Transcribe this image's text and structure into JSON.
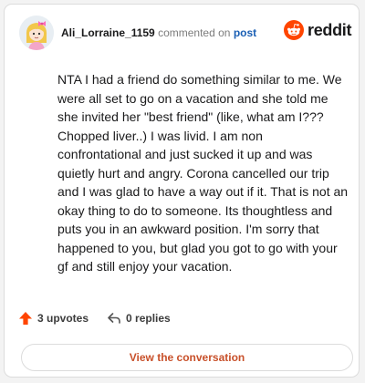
{
  "header": {
    "username": "Ali_Lorraine_1159",
    "action": "commented on",
    "post_link": "post",
    "brand": "reddit"
  },
  "comment": {
    "text": "NTA I had a friend do something similar to me. We were all set to go on a vacation and she told me she invited her \"best friend\" (like, what am I??? Chopped liver..) I was livid. I am non confrontational and just sucked it up and was quietly hurt and angry. Corona cancelled our trip and I was glad to have a way out if it. That is not an okay thing to do to someone. Its thoughtless and puts you in an awkward position. I'm sorry that happened to you, but glad you got to go with your gf and still enjoy your vacation."
  },
  "stats": {
    "upvotes": "3 upvotes",
    "replies": "0 replies"
  },
  "footer": {
    "view_button": "View the conversation"
  },
  "colors": {
    "reddit_orange": "#ff4500",
    "upvote": "#ff4500",
    "link_blue": "#1a5fb4",
    "button_text": "#c8502a"
  },
  "icons": {
    "avatar": "snoo-avatar-icon",
    "brand": "reddit-logo-icon",
    "upvote": "upvote-arrow-icon",
    "reply": "reply-arrow-icon"
  }
}
